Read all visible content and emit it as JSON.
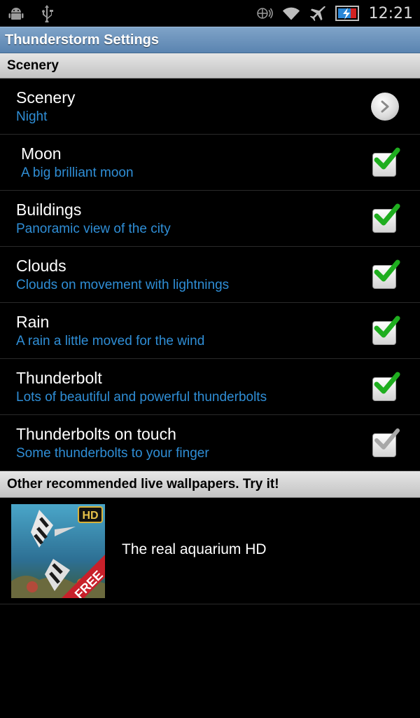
{
  "status_bar": {
    "time": "12:21",
    "left_icons": [
      "android-debug-icon",
      "usb-icon"
    ],
    "right_icons": [
      "sync-icon",
      "wifi-icon",
      "airplane-icon",
      "battery-charging-icon"
    ]
  },
  "app": {
    "title": "Thunderstorm Settings"
  },
  "sections": {
    "scenery_header": "Scenery",
    "recommended_header": "Other recommended live wallpapers. Try it!"
  },
  "prefs": [
    {
      "title": "Scenery",
      "summary": "Night",
      "widget": "arrow",
      "checked": null
    },
    {
      "title": "Moon",
      "summary": "A big brilliant moon",
      "widget": "checkbox",
      "checked": true
    },
    {
      "title": "Buildings",
      "summary": "Panoramic view of the city",
      "widget": "checkbox",
      "checked": true
    },
    {
      "title": "Clouds",
      "summary": "Clouds on movement with lightnings",
      "widget": "checkbox",
      "checked": true
    },
    {
      "title": "Rain",
      "summary": "A rain a little moved for the wind",
      "widget": "checkbox",
      "checked": true
    },
    {
      "title": "Thunderbolt",
      "summary": "Lots of beautiful and powerful thunderbolts",
      "widget": "checkbox",
      "checked": true
    },
    {
      "title": "Thunderbolts on touch",
      "summary": "Some thunderbolts to your finger",
      "widget": "checkbox",
      "checked": false
    }
  ],
  "recommended": [
    {
      "title": "The real aquarium HD",
      "badge_top": "HD",
      "ribbon": "FREE"
    }
  ],
  "colors": {
    "summary_blue": "#2f8ed6",
    "title_bar": "#6a93bd",
    "check_green": "#1fae1f",
    "check_gray": "#a8a8a8"
  }
}
